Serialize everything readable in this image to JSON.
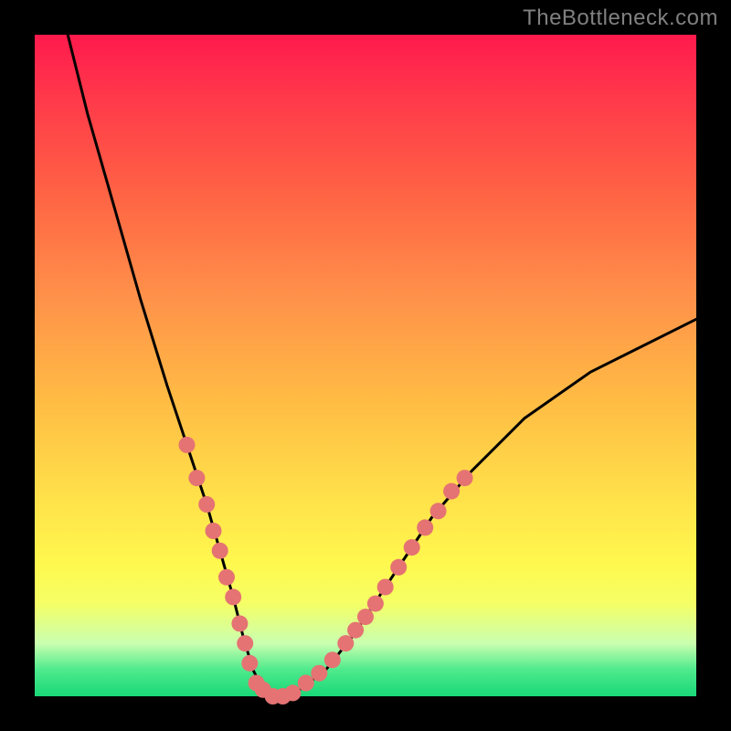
{
  "watermark": "TheBottleneck.com",
  "chart_data": {
    "type": "line",
    "title": "",
    "xlabel": "",
    "ylabel": "",
    "xlim": [
      0,
      100
    ],
    "ylim": [
      0,
      100
    ],
    "grid": false,
    "legend": false,
    "annotations": [],
    "background_gradient": {
      "orientation": "vertical",
      "stops": [
        {
          "pos": 0.0,
          "color": "#ff1a4d"
        },
        {
          "pos": 0.25,
          "color": "#ff6644"
        },
        {
          "pos": 0.55,
          "color": "#ffbb44"
        },
        {
          "pos": 0.8,
          "color": "#fff84e"
        },
        {
          "pos": 0.96,
          "color": "#4eea8c"
        },
        {
          "pos": 1.0,
          "color": "#19d877"
        }
      ]
    },
    "series": [
      {
        "name": "bottleneck-curve",
        "color": "#000000",
        "x": [
          5,
          8,
          12,
          16,
          20,
          23,
          26,
          28,
          30,
          31.5,
          33,
          34.5,
          36,
          38,
          40,
          44,
          48,
          52,
          56,
          60,
          66,
          74,
          84,
          96,
          100
        ],
        "y": [
          100,
          88,
          74,
          60,
          47,
          38,
          29,
          22,
          15,
          9,
          4,
          1,
          0,
          0,
          1,
          4,
          9,
          15,
          21,
          27,
          34,
          42,
          49,
          55,
          57
        ]
      }
    ],
    "markers": {
      "name": "highlighted-points",
      "color": "#e57373",
      "points": [
        {
          "x": 23.0,
          "y": 38
        },
        {
          "x": 24.5,
          "y": 33
        },
        {
          "x": 26.0,
          "y": 29
        },
        {
          "x": 27.0,
          "y": 25
        },
        {
          "x": 28.0,
          "y": 22
        },
        {
          "x": 29.0,
          "y": 18
        },
        {
          "x": 30.0,
          "y": 15
        },
        {
          "x": 31.0,
          "y": 11
        },
        {
          "x": 31.8,
          "y": 8
        },
        {
          "x": 32.5,
          "y": 5
        },
        {
          "x": 33.5,
          "y": 2
        },
        {
          "x": 34.5,
          "y": 1
        },
        {
          "x": 36.0,
          "y": 0
        },
        {
          "x": 37.5,
          "y": 0
        },
        {
          "x": 39.0,
          "y": 0.5
        },
        {
          "x": 41.0,
          "y": 2
        },
        {
          "x": 43.0,
          "y": 3.5
        },
        {
          "x": 45.0,
          "y": 5.5
        },
        {
          "x": 47.0,
          "y": 8
        },
        {
          "x": 48.5,
          "y": 10
        },
        {
          "x": 50.0,
          "y": 12
        },
        {
          "x": 51.5,
          "y": 14
        },
        {
          "x": 53.0,
          "y": 16.5
        },
        {
          "x": 55.0,
          "y": 19.5
        },
        {
          "x": 57.0,
          "y": 22.5
        },
        {
          "x": 59.0,
          "y": 25.5
        },
        {
          "x": 61.0,
          "y": 28
        },
        {
          "x": 63.0,
          "y": 31
        },
        {
          "x": 65.0,
          "y": 33
        }
      ]
    }
  }
}
